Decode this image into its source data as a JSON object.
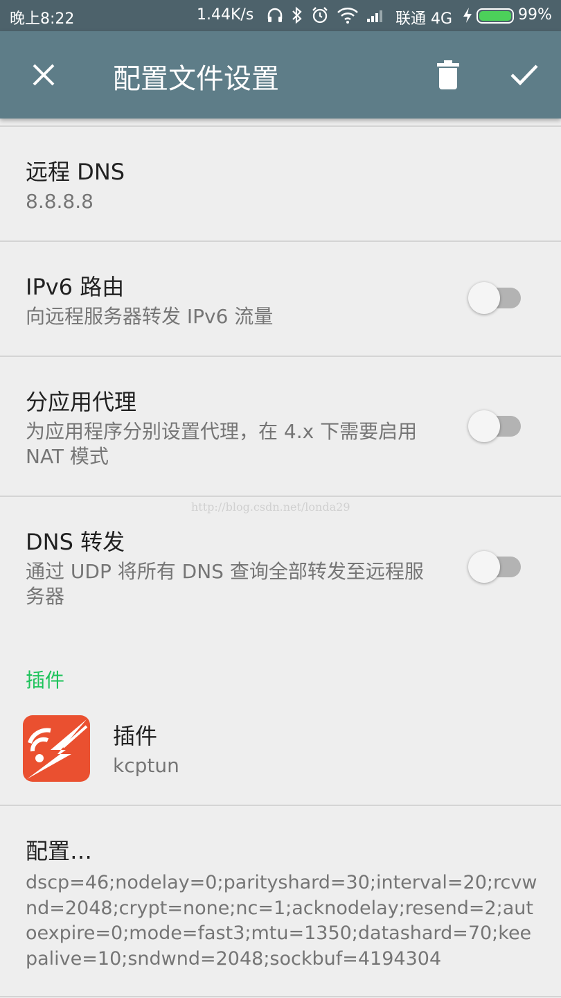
{
  "status_bar": {
    "time": "晚上8:22",
    "net_speed": "1.44K/s",
    "carrier": "联通 4G",
    "battery_percent": "99%",
    "battery_level": 0.99,
    "battery_color": "#4cd05a",
    "icons": [
      "headphone-icon",
      "bluetooth-icon",
      "alarm-icon",
      "wifi-icon",
      "signal-icon",
      "charging-icon",
      "battery-icon"
    ]
  },
  "app_bar": {
    "title": "配置文件设置",
    "close_icon": "close-icon",
    "delete_icon": "trash-icon",
    "confirm_icon": "check-icon",
    "background": "#5e7d88"
  },
  "preferences": {
    "remote_dns": {
      "title": "远程 DNS",
      "value": "8.8.8.8"
    },
    "ipv6_route": {
      "title": "IPv6 路由",
      "summary": "向远程服务器转发 IPv6 流量",
      "enabled": false
    },
    "per_app_proxy": {
      "title": "分应用代理",
      "summary": "为应用程序分别设置代理，在 4.x 下需要启用 NAT 模式",
      "enabled": false
    },
    "dns_forward": {
      "title": "DNS 转发",
      "summary": "通过 UDP 将所有 DNS 查询全部转发至远程服务器",
      "enabled": false
    }
  },
  "plugin_section": {
    "header": "插件",
    "header_color": "#1ec35b",
    "plugin": {
      "title": "插件",
      "value": "kcptun",
      "icon": "kcptun-plugin-icon",
      "icon_color": "#ea5030"
    },
    "config": {
      "title": "配置…",
      "value": "dscp=46;nodelay=0;parityshard=30;interval=20;rcvwnd=2048;crypt=none;nc=1;acknodelay;resend=2;autoexpire=0;mode=fast3;mtu=1350;datashard=70;keepalive=10;sndwnd=2048;sockbuf=4194304"
    }
  },
  "watermark": "http://blog.csdn.net/londa29"
}
